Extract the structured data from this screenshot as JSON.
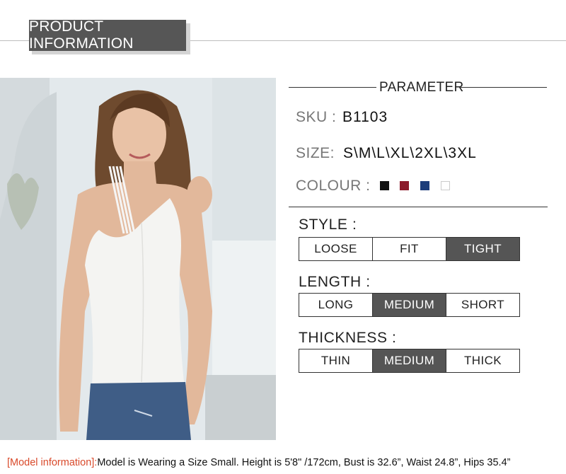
{
  "header": {
    "title": "PRODUCT INFORMATION"
  },
  "parameter": {
    "title": "PARAMETER",
    "sku_label": "SKU :",
    "sku_value": "B1103",
    "size_label": "SIZE:",
    "size_value": "S\\M\\L\\XL\\2XL\\3XL",
    "colour_label": "COLOUR :",
    "colours": [
      "#111111",
      "#8b1a2b",
      "#1d3d7a",
      "#ffffff"
    ]
  },
  "style": {
    "label": "STYLE :",
    "options": [
      "LOOSE",
      "FIT",
      "TIGHT"
    ],
    "selected": "TIGHT"
  },
  "length": {
    "label": "LENGTH :",
    "options": [
      "LONG",
      "MEDIUM",
      "SHORT"
    ],
    "selected": "MEDIUM"
  },
  "thickness": {
    "label": "THICKNESS :",
    "options": [
      "THIN",
      "MEDIUM",
      "THICK"
    ],
    "selected": "MEDIUM"
  },
  "footer": {
    "highlight": "[Model information]:",
    "text": "Model is Wearing a Size Small. Height is 5'8\" /172cm, Bust is 32.6”, Waist 24.8”, Hips 35.4”"
  },
  "colors": {
    "header_bg": "#565656",
    "selected_bg": "#555555",
    "highlight": "#d94a2b"
  }
}
